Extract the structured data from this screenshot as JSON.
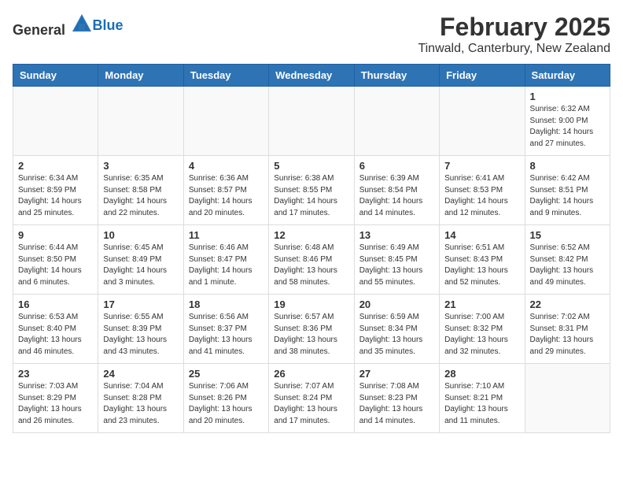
{
  "header": {
    "logo_general": "General",
    "logo_blue": "Blue",
    "title": "February 2025",
    "subtitle": "Tinwald, Canterbury, New Zealand"
  },
  "weekdays": [
    "Sunday",
    "Monday",
    "Tuesday",
    "Wednesday",
    "Thursday",
    "Friday",
    "Saturday"
  ],
  "weeks": [
    [
      {
        "day": "",
        "info": ""
      },
      {
        "day": "",
        "info": ""
      },
      {
        "day": "",
        "info": ""
      },
      {
        "day": "",
        "info": ""
      },
      {
        "day": "",
        "info": ""
      },
      {
        "day": "",
        "info": ""
      },
      {
        "day": "1",
        "info": "Sunrise: 6:32 AM\nSunset: 9:00 PM\nDaylight: 14 hours\nand 27 minutes."
      }
    ],
    [
      {
        "day": "2",
        "info": "Sunrise: 6:34 AM\nSunset: 8:59 PM\nDaylight: 14 hours\nand 25 minutes."
      },
      {
        "day": "3",
        "info": "Sunrise: 6:35 AM\nSunset: 8:58 PM\nDaylight: 14 hours\nand 22 minutes."
      },
      {
        "day": "4",
        "info": "Sunrise: 6:36 AM\nSunset: 8:57 PM\nDaylight: 14 hours\nand 20 minutes."
      },
      {
        "day": "5",
        "info": "Sunrise: 6:38 AM\nSunset: 8:55 PM\nDaylight: 14 hours\nand 17 minutes."
      },
      {
        "day": "6",
        "info": "Sunrise: 6:39 AM\nSunset: 8:54 PM\nDaylight: 14 hours\nand 14 minutes."
      },
      {
        "day": "7",
        "info": "Sunrise: 6:41 AM\nSunset: 8:53 PM\nDaylight: 14 hours\nand 12 minutes."
      },
      {
        "day": "8",
        "info": "Sunrise: 6:42 AM\nSunset: 8:51 PM\nDaylight: 14 hours\nand 9 minutes."
      }
    ],
    [
      {
        "day": "9",
        "info": "Sunrise: 6:44 AM\nSunset: 8:50 PM\nDaylight: 14 hours\nand 6 minutes."
      },
      {
        "day": "10",
        "info": "Sunrise: 6:45 AM\nSunset: 8:49 PM\nDaylight: 14 hours\nand 3 minutes."
      },
      {
        "day": "11",
        "info": "Sunrise: 6:46 AM\nSunset: 8:47 PM\nDaylight: 14 hours\nand 1 minute."
      },
      {
        "day": "12",
        "info": "Sunrise: 6:48 AM\nSunset: 8:46 PM\nDaylight: 13 hours\nand 58 minutes."
      },
      {
        "day": "13",
        "info": "Sunrise: 6:49 AM\nSunset: 8:45 PM\nDaylight: 13 hours\nand 55 minutes."
      },
      {
        "day": "14",
        "info": "Sunrise: 6:51 AM\nSunset: 8:43 PM\nDaylight: 13 hours\nand 52 minutes."
      },
      {
        "day": "15",
        "info": "Sunrise: 6:52 AM\nSunset: 8:42 PM\nDaylight: 13 hours\nand 49 minutes."
      }
    ],
    [
      {
        "day": "16",
        "info": "Sunrise: 6:53 AM\nSunset: 8:40 PM\nDaylight: 13 hours\nand 46 minutes."
      },
      {
        "day": "17",
        "info": "Sunrise: 6:55 AM\nSunset: 8:39 PM\nDaylight: 13 hours\nand 43 minutes."
      },
      {
        "day": "18",
        "info": "Sunrise: 6:56 AM\nSunset: 8:37 PM\nDaylight: 13 hours\nand 41 minutes."
      },
      {
        "day": "19",
        "info": "Sunrise: 6:57 AM\nSunset: 8:36 PM\nDaylight: 13 hours\nand 38 minutes."
      },
      {
        "day": "20",
        "info": "Sunrise: 6:59 AM\nSunset: 8:34 PM\nDaylight: 13 hours\nand 35 minutes."
      },
      {
        "day": "21",
        "info": "Sunrise: 7:00 AM\nSunset: 8:32 PM\nDaylight: 13 hours\nand 32 minutes."
      },
      {
        "day": "22",
        "info": "Sunrise: 7:02 AM\nSunset: 8:31 PM\nDaylight: 13 hours\nand 29 minutes."
      }
    ],
    [
      {
        "day": "23",
        "info": "Sunrise: 7:03 AM\nSunset: 8:29 PM\nDaylight: 13 hours\nand 26 minutes."
      },
      {
        "day": "24",
        "info": "Sunrise: 7:04 AM\nSunset: 8:28 PM\nDaylight: 13 hours\nand 23 minutes."
      },
      {
        "day": "25",
        "info": "Sunrise: 7:06 AM\nSunset: 8:26 PM\nDaylight: 13 hours\nand 20 minutes."
      },
      {
        "day": "26",
        "info": "Sunrise: 7:07 AM\nSunset: 8:24 PM\nDaylight: 13 hours\nand 17 minutes."
      },
      {
        "day": "27",
        "info": "Sunrise: 7:08 AM\nSunset: 8:23 PM\nDaylight: 13 hours\nand 14 minutes."
      },
      {
        "day": "28",
        "info": "Sunrise: 7:10 AM\nSunset: 8:21 PM\nDaylight: 13 hours\nand 11 minutes."
      },
      {
        "day": "",
        "info": ""
      }
    ]
  ]
}
